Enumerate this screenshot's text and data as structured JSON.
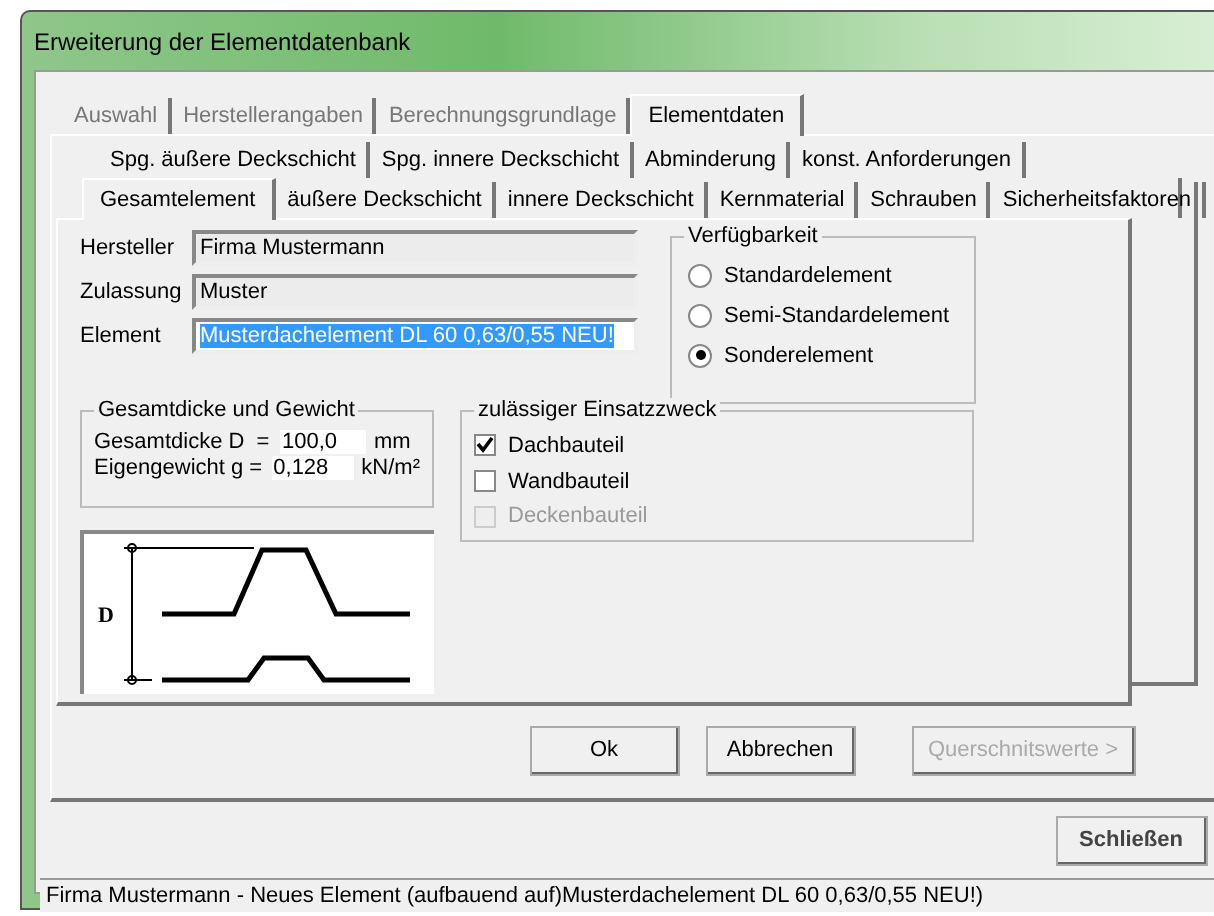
{
  "window": {
    "title": "Erweiterung der Elementdatenbank"
  },
  "tabs": [
    {
      "label": "Auswahl",
      "selected": false
    },
    {
      "label": "Herstellerangaben",
      "selected": false
    },
    {
      "label": "Berechnungsgrundlage",
      "selected": false
    },
    {
      "label": "Elementdaten",
      "selected": true
    }
  ],
  "subtab_rows": [
    [
      {
        "label": "Spg. äußere Deckschicht",
        "selected": false
      },
      {
        "label": "Spg. innere Deckschicht",
        "selected": false
      },
      {
        "label": "Abminderung",
        "selected": false
      },
      {
        "label": "konst. Anforderungen",
        "selected": false
      }
    ],
    [
      {
        "label": "Gesamtelement",
        "selected": true
      },
      {
        "label": "äußere Deckschicht",
        "selected": false
      },
      {
        "label": "innere Deckschicht",
        "selected": false
      },
      {
        "label": "Kernmaterial",
        "selected": false
      },
      {
        "label": "Schrauben",
        "selected": false
      },
      {
        "label": "Sicherheitsfaktoren",
        "selected": false
      }
    ]
  ],
  "fields": [
    {
      "label": "Hersteller",
      "value": "Firma Mustermann",
      "readonly": true,
      "text_selected": false
    },
    {
      "label": "Zulassung",
      "value": "Muster",
      "readonly": true,
      "text_selected": false
    },
    {
      "label": "Element",
      "value": "Musterdachelement DL 60 0,63/0,55 NEU!",
      "readonly": false,
      "text_selected": true
    }
  ],
  "availability": {
    "title": "Verfügbarkeit",
    "options": [
      {
        "label": "Standardelement",
        "selected": false
      },
      {
        "label": "Semi-Standardelement",
        "selected": false
      },
      {
        "label": "Sonderelement",
        "selected": true
      }
    ]
  },
  "thickness": {
    "title": "Gesamtdicke und Gewicht",
    "rows": [
      {
        "label": "Gesamtdicke D  =",
        "value": "100,0",
        "unit": "mm"
      },
      {
        "label": "Eigengewicht g =",
        "value": "0,128",
        "unit": "kN/m²"
      }
    ]
  },
  "usage": {
    "title": "zulässiger Einsatzzweck",
    "options": [
      {
        "label": "Dachbauteil",
        "checked": true,
        "disabled": false
      },
      {
        "label": "Wandbauteil",
        "checked": false,
        "disabled": false
      },
      {
        "label": "Deckenbauteil",
        "checked": false,
        "disabled": true
      }
    ]
  },
  "drawing": {
    "dimension_label": "D"
  },
  "buttons": [
    {
      "label": "Ok",
      "disabled": false
    },
    {
      "label": "Abbrechen",
      "disabled": false
    },
    {
      "label": "Querschnitswerte >",
      "disabled": true
    }
  ],
  "close_button": {
    "label": "Schließen"
  },
  "status_bar": "Firma Mustermann - Neues Element  (aufbauend auf)Musterdachelement DL 60 0,63/0,55 NEU!)"
}
